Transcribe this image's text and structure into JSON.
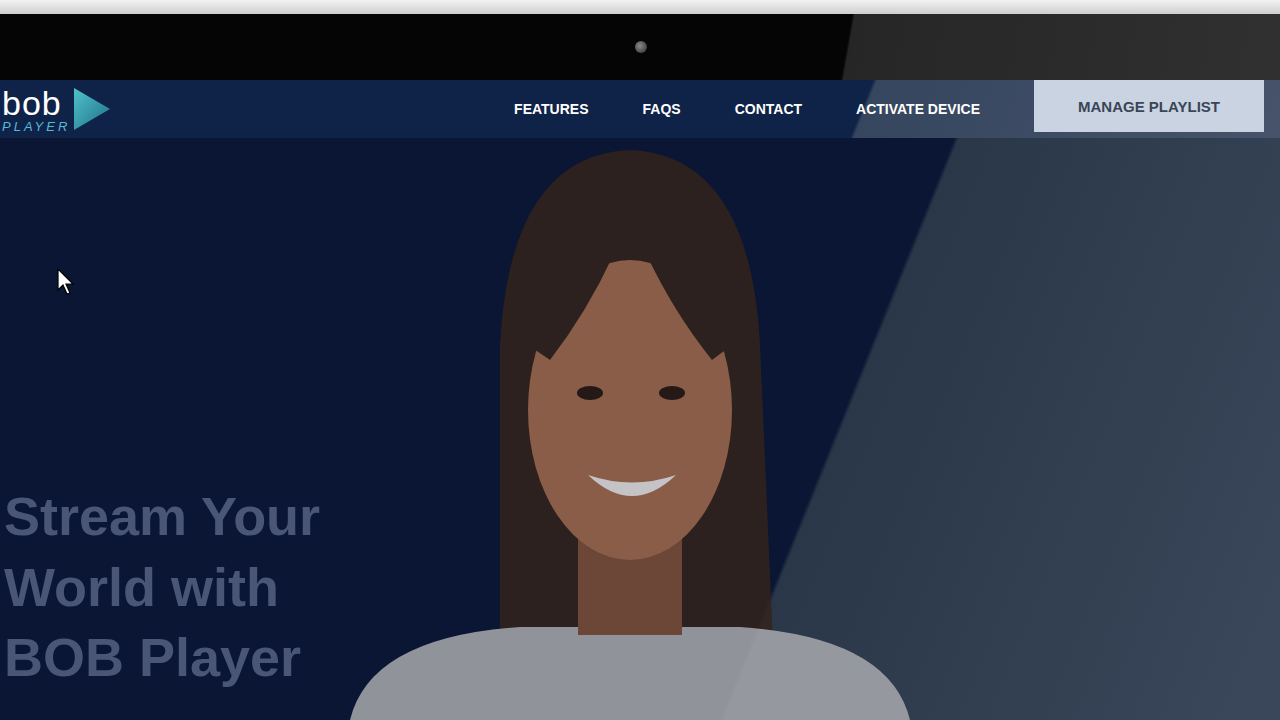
{
  "logo": {
    "name": "bob",
    "sub": "PLAYER"
  },
  "nav": {
    "links": [
      "FEATURES",
      "FAQS",
      "CONTACT",
      "ACTIVATE DEVICE"
    ],
    "button": "MANAGE PLAYLIST"
  },
  "hero": {
    "lines": [
      "Stream Your",
      "World with",
      "BOB Player"
    ]
  }
}
